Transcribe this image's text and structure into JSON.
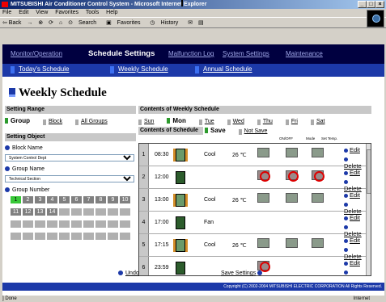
{
  "window": {
    "title": "MITSUBISHI Air Conditioner Control System - Microsoft Internet Explorer"
  },
  "menubar": [
    "File",
    "Edit",
    "View",
    "Favorites",
    "Tools",
    "Help"
  ],
  "toolbar": {
    "back": "⇦ Back",
    "forward": "→",
    "search": "Search",
    "favorites": "Favorites",
    "history": "History"
  },
  "nav": {
    "items": [
      "Monitor/Operation",
      "Schedule Settings",
      "Malfunction Log",
      "System Settings",
      "Maintenance"
    ],
    "selected": "Schedule Settings",
    "logo": "MITSUBISHI ELECTRIC"
  },
  "subnav": [
    "Today's Schedule",
    "Weekly Schedule",
    "Annual Schedule"
  ],
  "page": {
    "title": "Weekly Schedule",
    "setting_range": {
      "header": "Setting Range",
      "options": [
        "Group",
        "Block",
        "All Groups"
      ],
      "selected": "Group"
    },
    "setting_object": {
      "header": "Setting Object",
      "block_label": "Block Name",
      "block_value": "System Control Dept",
      "group_label": "Group Name",
      "group_value": "Technical Section",
      "number_label": "Group Number",
      "numbers": [
        "1",
        "2",
        "3",
        "4",
        "5",
        "6",
        "7",
        "8",
        "9",
        "10",
        "11",
        "12",
        "13",
        "14"
      ],
      "selected_number": "1"
    },
    "weekly": {
      "header": "Contents of Weekly Schedule",
      "days": [
        "Sun",
        "Mon",
        "Tue",
        "Wed",
        "Thu",
        "Fri",
        "Sat"
      ],
      "selected_day": "Mon"
    },
    "schedule": {
      "header": "Contents of Schedule",
      "save_options": [
        "Save",
        "Not Save"
      ],
      "selected_save": "Save",
      "col_headers": [
        "ON/OFF",
        "Mode",
        "Set Temp."
      ],
      "rows": [
        {
          "num": "1",
          "time": "08:30",
          "on": true,
          "mode": "Cool",
          "temp": "26 ℃"
        },
        {
          "num": "2",
          "time": "12:00",
          "on": false,
          "mode": "",
          "temp": ""
        },
        {
          "num": "3",
          "time": "13:00",
          "on": true,
          "mode": "Cool",
          "temp": "26 ℃"
        },
        {
          "num": "4",
          "time": "17:00",
          "on": null,
          "mode": "Fan",
          "temp": ""
        },
        {
          "num": "5",
          "time": "17:15",
          "on": true,
          "mode": "Cool",
          "temp": "26 ℃"
        },
        {
          "num": "6",
          "time": "23:59",
          "on": false,
          "mode": "",
          "temp": ""
        }
      ],
      "edit_label": "Edit",
      "delete_label": "Delete"
    },
    "undo": "Undo",
    "save_settings": "Save Settings",
    "copyright": "Copyright (C) 2002-2004 MITSUBISHI ELECTRIC CORPORATION All Rights Reserved."
  },
  "statusbar": {
    "left": "] Done",
    "right": "Internet"
  }
}
